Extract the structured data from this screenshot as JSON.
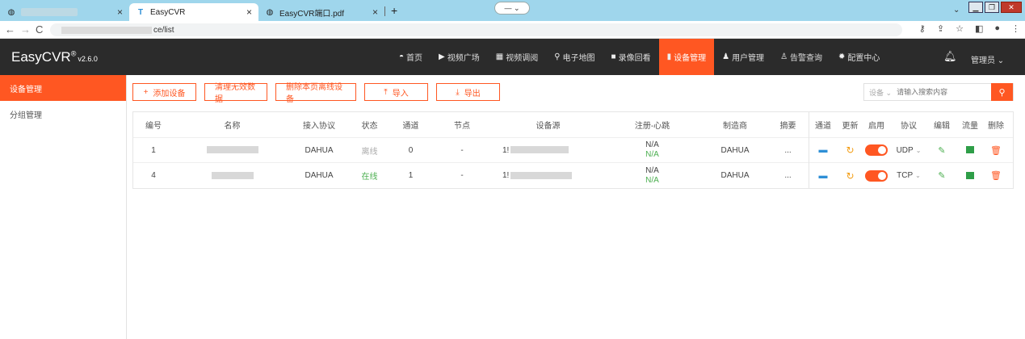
{
  "browser": {
    "tabs": [
      {
        "label": "",
        "close": "×"
      },
      {
        "label": "EasyCVR",
        "close": "×"
      },
      {
        "label": "EasyCVR端口.pdf",
        "close": "×"
      }
    ],
    "new_tab": "+",
    "url_suffix": "ce/list"
  },
  "app": {
    "logo": "EasyCVR",
    "logo_mark": "®",
    "version": "v2.6.0",
    "nav": [
      {
        "label": "首页",
        "icon": "dashboard-icon"
      },
      {
        "label": "视频广场",
        "icon": "play-circle-icon"
      },
      {
        "label": "视频调阅",
        "icon": "grid-icon"
      },
      {
        "label": "电子地图",
        "icon": "map-pin-icon"
      },
      {
        "label": "录像回看",
        "icon": "video-camera-icon"
      },
      {
        "label": "设备管理",
        "icon": "device-icon"
      },
      {
        "label": "用户管理",
        "icon": "user-icon"
      },
      {
        "label": "告警查询",
        "icon": "alarm-icon"
      },
      {
        "label": "配置中心",
        "icon": "gear-icon"
      }
    ],
    "admin": "管理员"
  },
  "sidebar": {
    "items": [
      {
        "label": "设备管理"
      },
      {
        "label": "分组管理"
      }
    ]
  },
  "toolbar": {
    "add": "添加设备",
    "clean": "清理无效数据",
    "delete_offline": "删除本页离线设备",
    "import": "导入",
    "export": "导出"
  },
  "search": {
    "select": "设备",
    "placeholder": "请输入搜索内容"
  },
  "table": {
    "headers": [
      "编号",
      "名称",
      "接入协议",
      "状态",
      "通道",
      "节点",
      "设备源",
      "注册-心跳",
      "制造商",
      "摘要",
      "通道",
      "更新",
      "启用",
      "协议",
      "编辑",
      "流量",
      "删除"
    ],
    "rows": [
      {
        "id": "1",
        "protocol": "DAHUA",
        "status": "离线",
        "channel": "0",
        "node": "-",
        "source_prefix": "1!",
        "reg": "N/A",
        "heartbeat": "N/A",
        "maker": "DAHUA",
        "summary": "...",
        "transport": "UDP"
      },
      {
        "id": "4",
        "protocol": "DAHUA",
        "status": "在线",
        "channel": "1",
        "node": "-",
        "source_prefix": "1!",
        "reg": "N/A",
        "heartbeat": "N/A",
        "maker": "DAHUA",
        "summary": "...",
        "transport": "TCP"
      }
    ]
  }
}
